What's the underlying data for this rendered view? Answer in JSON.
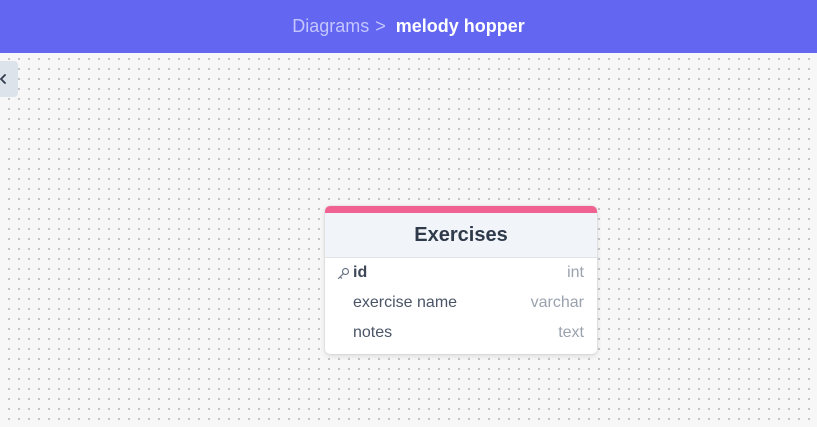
{
  "breadcrumb": {
    "root": "Diagrams",
    "separator": ">",
    "current": "melody hopper"
  },
  "colors": {
    "topbar": "#6366f1",
    "table_accent": "#f06292"
  },
  "sidebar_toggle": {
    "icon": "chevron-left-icon"
  },
  "table": {
    "name": "Exercises",
    "fields": [
      {
        "name": "id",
        "type": "int",
        "primary_key": true,
        "icon": "key-icon"
      },
      {
        "name": "exercise name",
        "type": "varchar",
        "primary_key": false
      },
      {
        "name": "notes",
        "type": "text",
        "primary_key": false
      }
    ]
  }
}
